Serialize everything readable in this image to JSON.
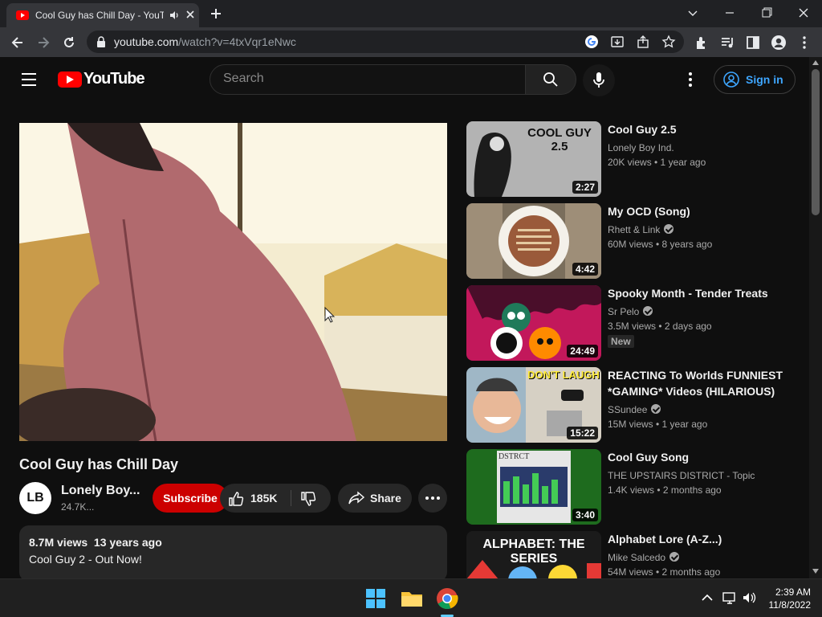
{
  "browser": {
    "tab_title": "Cool Guy has Chill Day - YouTube",
    "url_host": "youtube.com",
    "url_path": "/watch?v=4txVqr1eNwc"
  },
  "masthead": {
    "logo_text": "YouTube",
    "search_placeholder": "Search",
    "signin_label": "Sign in"
  },
  "video": {
    "title": "Cool Guy has Chill Day",
    "channel_initials": "LB",
    "channel_name": "Lonely Boy...",
    "subscribers": "24.7K...",
    "subscribe_label": "Subscribe",
    "likes": "185K",
    "share_label": "Share",
    "views_date": "8.7M views  13 years ago",
    "description": "Cool Guy 2 - Out Now!"
  },
  "related": [
    {
      "title": "Cool Guy 2.5",
      "channel": "Lonely Boy Ind.",
      "verified": false,
      "meta": "20K views • 1 year ago",
      "duration": "2:27",
      "thumb_text": "COOL GUY 2.5"
    },
    {
      "title": "My OCD (Song)",
      "channel": "Rhett & Link",
      "verified": true,
      "meta": "60M views • 8 years ago",
      "duration": "4:42"
    },
    {
      "title": "Spooky Month - Tender Treats",
      "channel": "Sr Pelo",
      "verified": true,
      "meta": "3.5M views • 2 days ago",
      "duration": "24:49",
      "badge": "New"
    },
    {
      "title": "REACTING To Worlds FUNNIEST *GAMING* Videos (HILARIOUS)",
      "channel": "SSundee",
      "verified": true,
      "meta": "15M views • 1 year ago",
      "duration": "15:22",
      "thumb_text": "DON'T LAUGH"
    },
    {
      "title": "Cool Guy Song",
      "channel": "THE UPSTAIRS DISTRICT - Topic",
      "verified": false,
      "meta": "1.4K views • 2 months ago",
      "duration": "3:40",
      "thumb_text": "DSTRCT"
    },
    {
      "title": "Alphabet Lore (A-Z...)",
      "channel": "Mike Salcedo",
      "verified": true,
      "meta": "54M views • 2 months ago",
      "duration": "",
      "thumb_text": "ALPHABET: THE SERIES"
    }
  ],
  "taskbar": {
    "time": "2:39 AM",
    "date": "11/8/2022"
  },
  "colors": {
    "background": "#0f0f0f",
    "subscribe_red": "#cc0000",
    "link_blue": "#3ea6ff",
    "chrome_frame": "#202124"
  }
}
